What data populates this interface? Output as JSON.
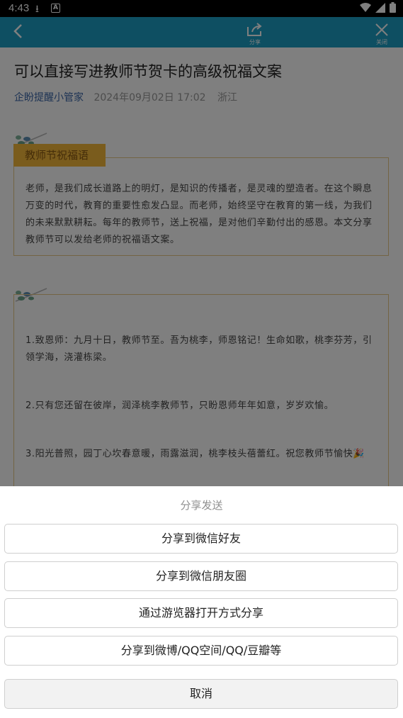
{
  "status_bar": {
    "time": "4:43"
  },
  "top_bar": {
    "share_label": "分享",
    "close_label": "关闭"
  },
  "article": {
    "title": "可以直接写进教师节贺卡的高级祝福文案",
    "author": "企盼提醒小管家",
    "date": "2024年09月02日 17:02",
    "location": "浙江",
    "section_tag": "教师节祝福语",
    "intro": "老师，是我们成长道路上的明灯，是知识的传播者，是灵魂的塑造者。在这个瞬息万变的时代，教育的重要性愈发凸显。而老师，始终坚守在教育的第一线，为我们的未来默默耕耘。每年的教师节，送上祝福，是对他们辛勤付出的感恩。本文分享教师节可以发给老师的祝福语文案。",
    "quotes": [
      "1.致恩师：九月十日，教师节至。吾为桃李，师恩铭记！生命如歌，桃李芬芳，引领学海，浇灌栋梁。",
      "2.只有您还留在彼岸，润泽桃李教师节，只盼恩师年年如意，岁岁欢愉。",
      "3.阳光普照，园丁心坎春意暖，雨露滋润，桃李枝头蓓蕾红。祝您教师节愉快🎉"
    ]
  },
  "share_sheet": {
    "title": "分享发送",
    "options": [
      "分享到微信好友",
      "分享到微信朋友圈",
      "通过游览器打开方式分享",
      "分享到微博/QQ空间/QQ/豆瓣等"
    ],
    "cancel": "取消"
  },
  "colors": {
    "top_bar": "#1c9fc4",
    "tag": "#f4b83a",
    "card_border": "#e6c889",
    "author": "#3a66a8"
  }
}
